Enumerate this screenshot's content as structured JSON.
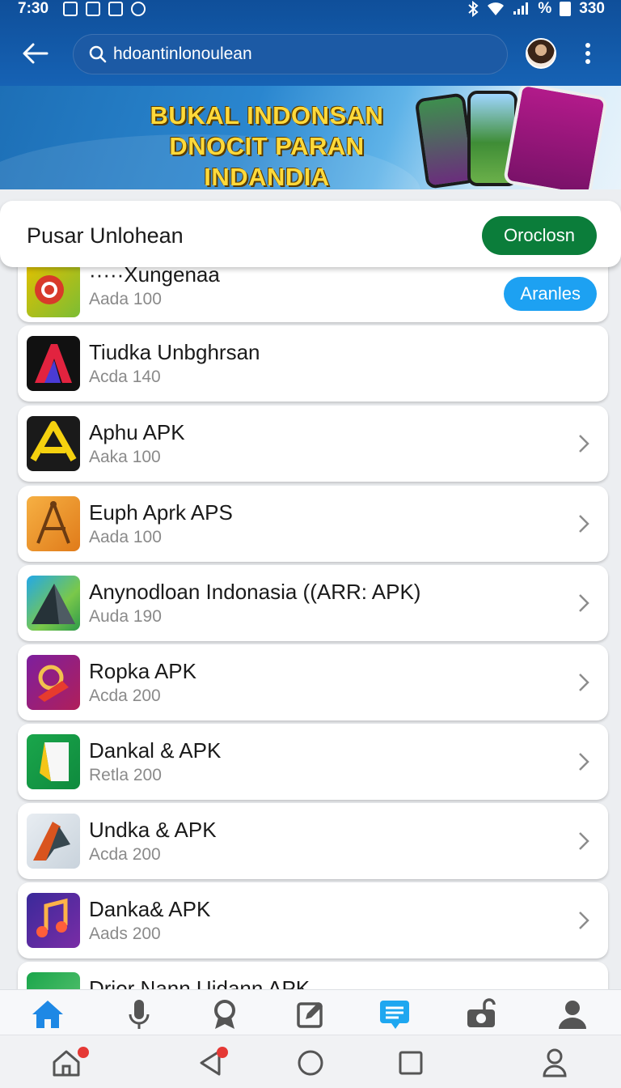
{
  "status_bar": {
    "time": "7:30",
    "signal_text": "%",
    "battery": "330"
  },
  "search": {
    "value": "hdoantinlonoulean"
  },
  "banner": {
    "line1": "BUKAL INDONSAN",
    "line2": "DNOCIT PARAN INDANDIA"
  },
  "section": {
    "title": "Pusar Unlohean",
    "button_label": "Oroclosn"
  },
  "apps": [
    {
      "name": "·····Xungenaa",
      "sub": "Aada 100",
      "action": "Aranles",
      "icon": "target-app-icon"
    },
    {
      "name": "Tiudka Unbghrsan",
      "sub": "Acda 140",
      "icon": "letter-a-app-icon"
    },
    {
      "name": "Aphu APK",
      "sub": "Aaka 100",
      "icon": "letter-a-yellow-app-icon"
    },
    {
      "name": "Euph Aprk APS",
      "sub": "Aada 100",
      "icon": "compass-app-icon"
    },
    {
      "name": "Anynodloan Indonasia ((ARR: APK)",
      "sub": "Auda 190",
      "icon": "mountain-app-icon"
    },
    {
      "name": "Ropka APK",
      "sub": "Acda 200",
      "icon": "wrench-app-icon"
    },
    {
      "name": "Dankal & APK",
      "sub": "Retla 200",
      "icon": "page-curl-app-icon"
    },
    {
      "name": "Undka & APK",
      "sub": "Acda 200",
      "icon": "plane-app-icon"
    },
    {
      "name": "Danka& APK",
      "sub": "Aads 200",
      "icon": "music-note-app-icon"
    },
    {
      "name": "Drior Nann Uidann APK",
      "sub": "",
      "icon": "cloud-app-icon"
    }
  ],
  "colors": {
    "appbar": "#1662b4",
    "accent_green": "#0b7d3a",
    "accent_blue": "#1da1f2",
    "nav_active": "#1e88e5"
  },
  "bottom_nav": [
    "home-icon",
    "microphone-icon",
    "award-icon",
    "edit-icon",
    "chat-icon",
    "camera-lock-icon",
    "profile-icon"
  ],
  "system_nav": [
    "home-icon",
    "back-icon",
    "circle-home-icon",
    "recents-icon",
    "person-icon"
  ]
}
